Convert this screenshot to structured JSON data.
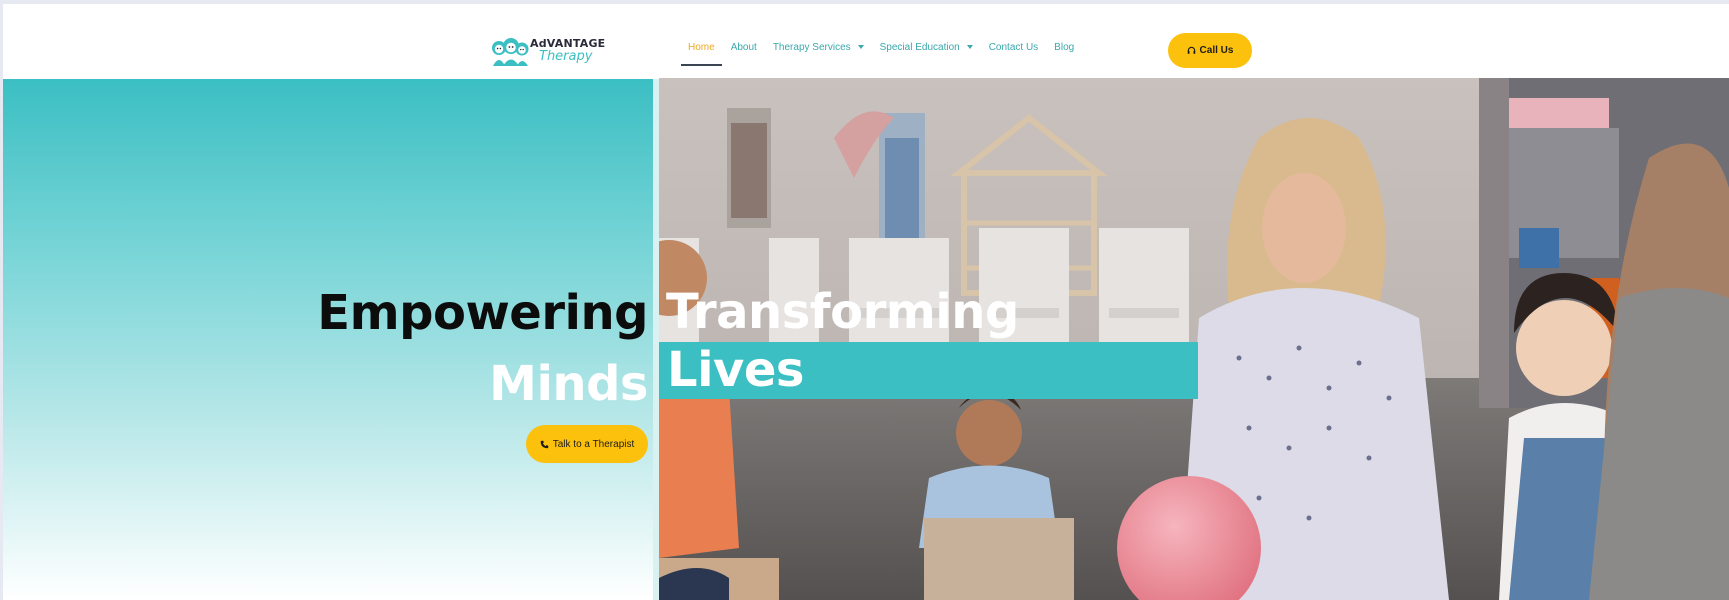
{
  "brand": {
    "logo_top_prefix": "Ad",
    "logo_top_rest": "VANTAGE",
    "logo_bottom": "Therapy"
  },
  "nav": {
    "items": [
      {
        "label": "Home",
        "active": true
      },
      {
        "label": "About"
      },
      {
        "label": "Therapy Services",
        "dropdown": true
      },
      {
        "label": "Special Education",
        "dropdown": true
      },
      {
        "label": "Contact Us"
      },
      {
        "label": "Blog"
      }
    ]
  },
  "header": {
    "call_label": "Call Us",
    "call_icon": "headset-icon"
  },
  "hero": {
    "word1": "Empowering",
    "word2": "Minds",
    "word3": "Transforming",
    "word4": "Lives",
    "cta_label": "Talk to a Therapist",
    "cta_icon": "phone-icon"
  },
  "colors": {
    "accent_teal": "#3bbfc3",
    "accent_yellow": "#fcc10c",
    "nav_text": "#3aa8ad",
    "nav_active": "#f0a91c"
  }
}
